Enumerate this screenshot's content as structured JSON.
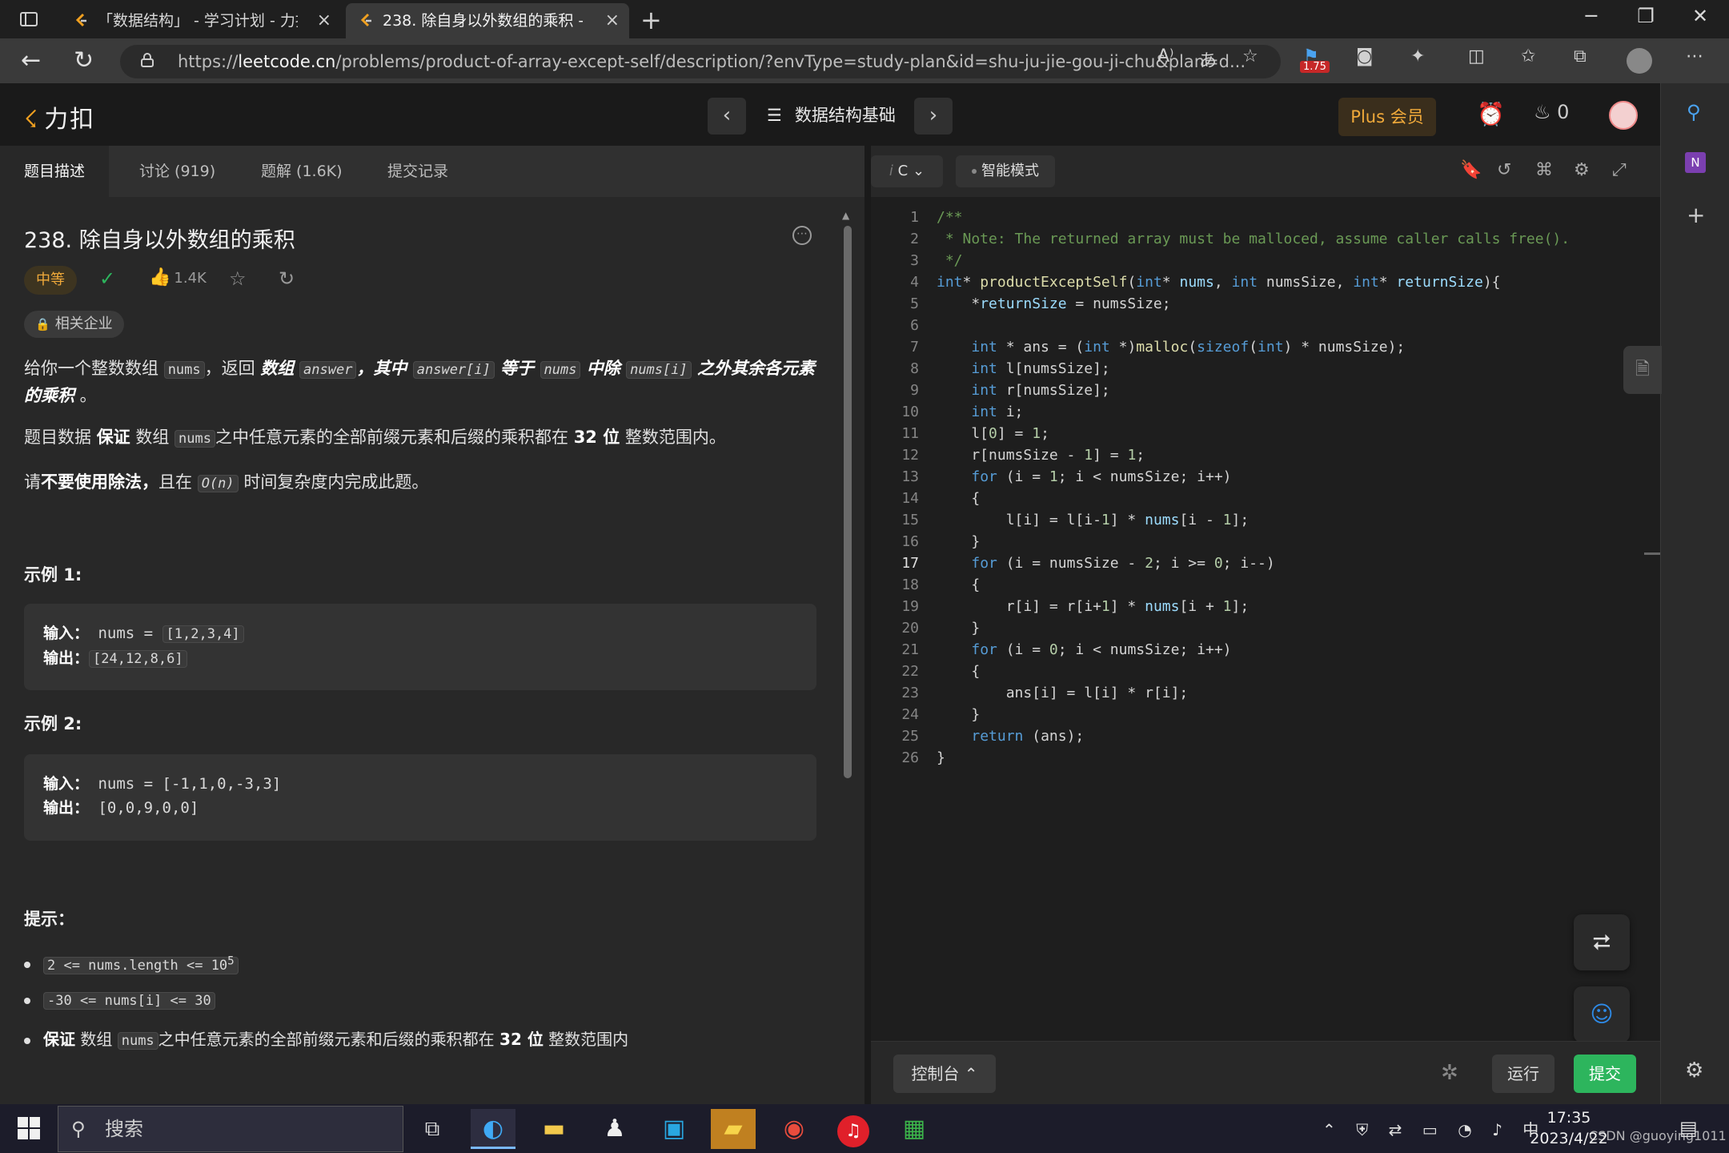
{
  "browser": {
    "tabs": [
      {
        "title": "「数据结构」 - 学习计划 - 力扣",
        "active": false
      },
      {
        "title": "238. 除自身以外数组的乘积 - 力扣",
        "active": true
      }
    ],
    "new_tab": "+",
    "url_prefix": "https://",
    "url_domain": "leetcode.cn",
    "url_rest": "/problems/product-of-array-except-self/description/?envType=study-plan&id=shu-ju-jie-gou-ji-chu&plan=d...",
    "extension_badge": "1.75"
  },
  "header": {
    "logo": "力扣",
    "plan_title": "数据结构基础",
    "plus": "Plus 会员",
    "streak": "0"
  },
  "problem": {
    "tabs": [
      "题目描述",
      "讨论 (919)",
      "题解 (1.6K)",
      "提交记录"
    ],
    "title": "238. 除自身以外数组的乘积",
    "difficulty": "中等",
    "likes": "1.4K",
    "company": "相关企业",
    "desc1": {
      "a": "给你一个整数数组 ",
      "code1": "nums",
      "b": "，返回 ",
      "c": "数组",
      "code2": "answer",
      "d": "，其中 ",
      "code3": "answer[i]",
      "e": " 等于 ",
      "code4": "nums",
      "f": " 中除 ",
      "code5": "nums[i]",
      "g": " 之外其余各元素的乘积",
      "h": " 。"
    },
    "desc2": {
      "a": "题目数据 ",
      "b": "保证",
      "c": " 数组 ",
      "code": "nums",
      "d": "之中任意元素的全部前缀元素和后缀的乘积都在  ",
      "e": "32 位",
      "f": " 整数范围内。"
    },
    "desc3": {
      "a": "请",
      "b": "不要使用除法，",
      "c": "且在 ",
      "code": "O(n)",
      "d": " 时间复杂度内完成此题。"
    },
    "example1": {
      "heading": "示例 1:",
      "in_label": "输入：",
      "in_text": " nums = ",
      "in_val": "[1,2,3,4]",
      "out_label": "输出：",
      "out_val": "[24,12,8,6]"
    },
    "example2": {
      "heading": "示例 2:",
      "in_label": "输入：",
      "in_text": " nums = [-1,1,0,-3,3]",
      "out_label": "输出：",
      "out_val": " [0,0,9,0,0]"
    },
    "hints_heading": "提示：",
    "hint1": {
      "code": "2 <= nums.length <= 10",
      "sup": "5"
    },
    "hint2": {
      "code": "-30 <= nums[i] <= 30"
    },
    "hint3": {
      "a": "保证",
      "b": " 数组 ",
      "code": "nums",
      "c": "之中任意元素的全部前缀元素和后缀的乘积都在  ",
      "d": "32 位",
      "e": " 整数范围内"
    }
  },
  "editor": {
    "lang": "C",
    "mode": "智能模式",
    "current_line": 17,
    "lines": [
      "/**",
      " * Note: The returned array must be malloced, assume caller calls free().",
      " */",
      "int* productExceptSelf(int* nums, int numsSize, int* returnSize){",
      "    *returnSize = numsSize;",
      "",
      "    int * ans = (int *)malloc(sizeof(int) * numsSize);",
      "    int l[numsSize];",
      "    int r[numsSize];",
      "    int i;",
      "    l[0] = 1;",
      "    r[numsSize - 1] = 1;",
      "    for (i = 1; i < numsSize; i++)",
      "    {",
      "        l[i] = l[i-1] * nums[i - 1];",
      "    }",
      "    for (i = numsSize - 2; i >= 0; i--)",
      "    {",
      "        r[i] = r[i+1] * nums[i + 1];",
      "    }",
      "    for (i = 0; i < numsSize; i++)",
      "    {",
      "        ans[i] = l[i] * r[i];",
      "    }",
      "    return (ans);",
      "}"
    ],
    "console": "控制台",
    "run": "运行",
    "submit": "提交"
  },
  "taskbar": {
    "search": "搜索",
    "ime": "中",
    "time": "17:35",
    "date": "2023/4/22",
    "watermark": "CSDN @guoying1011"
  },
  "colors": {
    "accent_orange": "#f0a93a",
    "submit_green": "#2db55d",
    "comment_green": "#6a9955",
    "keyword_blue": "#569cd6"
  }
}
